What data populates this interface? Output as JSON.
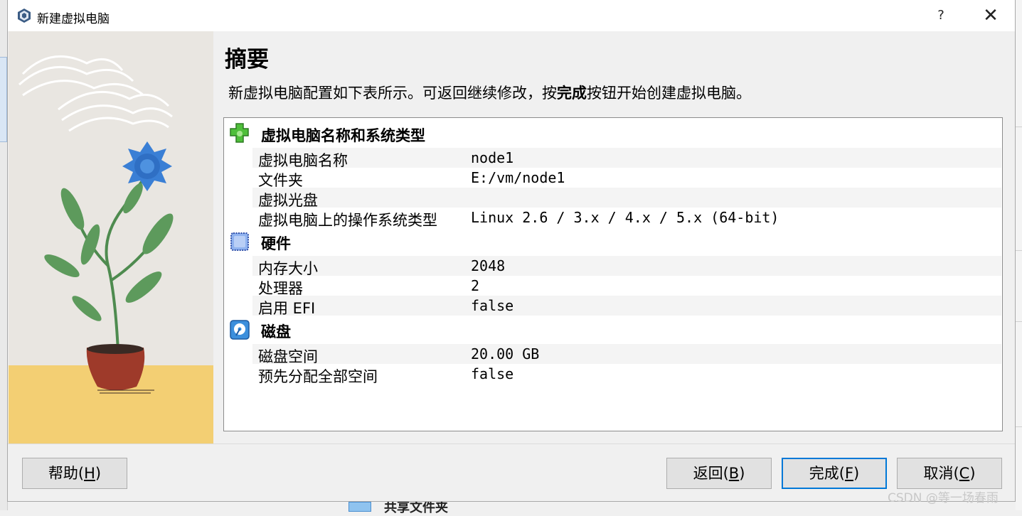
{
  "window": {
    "title": "新建虚拟电脑",
    "help_glyph": "?",
    "close_glyph": "✕"
  },
  "page": {
    "heading": "摘要",
    "description_before": "新虚拟电脑配置如下表所示。可返回继续修改，按",
    "description_bold": "完成",
    "description_after": "按钮开始创建虚拟电脑。"
  },
  "sections": {
    "general": {
      "title": "虚拟电脑名称和系统类型",
      "icon": "green-puzzle-icon",
      "rows": [
        {
          "key": "虚拟电脑名称",
          "value": "node1"
        },
        {
          "key": "文件夹",
          "value": "E:/vm/node1"
        },
        {
          "key": "虚拟光盘",
          "value": ""
        },
        {
          "key": "虚拟电脑上的操作系统类型",
          "value": "Linux 2.6 / 3.x / 4.x / 5.x (64-bit)"
        }
      ]
    },
    "hardware": {
      "title": "硬件",
      "icon": "chip-icon",
      "rows": [
        {
          "key": "内存大小",
          "value": "2048"
        },
        {
          "key": "处理器",
          "value": "2"
        },
        {
          "key": "启用 EFI",
          "value": "false"
        }
      ]
    },
    "disk": {
      "title": "磁盘",
      "icon": "hard-disk-icon",
      "rows": [
        {
          "key": "磁盘空间",
          "value": "20.00 GB"
        },
        {
          "key": "预先分配全部空间",
          "value": "false"
        }
      ]
    }
  },
  "buttons": {
    "help": {
      "label": "帮助(",
      "mnemonic": "H",
      "close": ")"
    },
    "back": {
      "label": "返回(",
      "mnemonic": "B",
      "close": ")"
    },
    "finish": {
      "label": "完成(",
      "mnemonic": "F",
      "close": ")"
    },
    "cancel": {
      "label": "取消(",
      "mnemonic": "C",
      "close": ")"
    }
  },
  "background": {
    "partial_text": "共享文件夹"
  },
  "watermark": "CSDN @等一场春雨",
  "colors": {
    "accent": "#0078d7",
    "flower": "#3a7fd5",
    "sand": "#f3cf73"
  }
}
